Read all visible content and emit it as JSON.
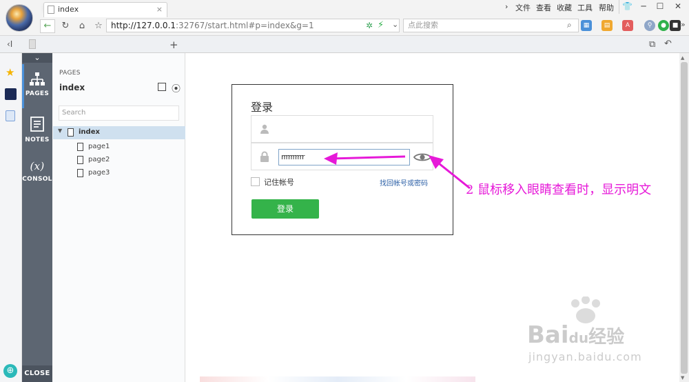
{
  "browser": {
    "menu": [
      "文件",
      "查看",
      "收藏",
      "工具",
      "帮助"
    ],
    "address": {
      "host": "http://127.0.0.1",
      "rest": ":32767/start.html#p=index&g=1"
    },
    "search_placeholder": "点此搜索",
    "tab_title": "index"
  },
  "toolbar": {
    "pages": "PAGES",
    "notes": "NOTES",
    "console_symbol": "(x)",
    "console": "CONSOL",
    "close": "CLOSE"
  },
  "pages_panel": {
    "heading": "PAGES",
    "current": "index",
    "search_placeholder": "Search",
    "tree": {
      "root": "index",
      "children": [
        "page1",
        "page2",
        "page3"
      ]
    }
  },
  "login": {
    "title": "登录",
    "password_value": "rrrrrrrrrr",
    "remember": "记住帐号",
    "forgot": "找回帐号或密码",
    "button": "登录"
  },
  "annotation": {
    "text": "2  鼠标移入眼睛查看时，显示明文"
  },
  "watermark": {
    "brand": "Bai",
    "brand2": "du",
    "suffix": "经验",
    "url": "jingyan.baidu.com"
  },
  "colors": {
    "accent_green": "#34b34a",
    "annotation": "#e619d8",
    "toolbar_dark": "#5d6672"
  }
}
